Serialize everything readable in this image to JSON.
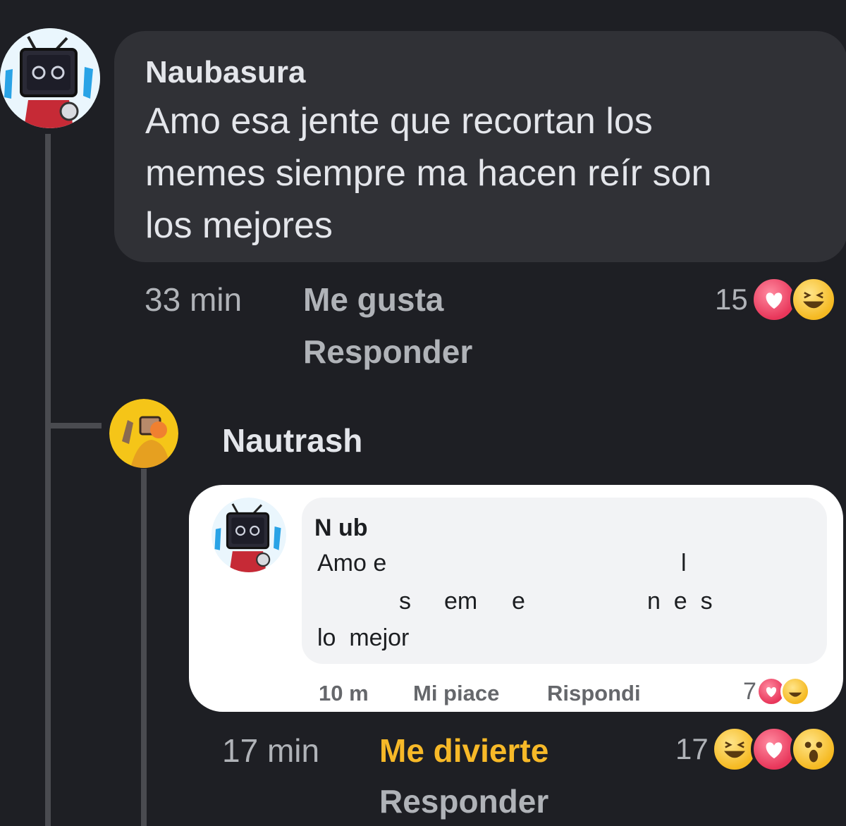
{
  "comment": {
    "author": "Naubasura",
    "text_lines": [
      "Amo esa jente que recortan los",
      "memes siempre ma hacen reír son",
      "los mejores"
    ],
    "time": "33 min",
    "like_label": "Me gusta",
    "reply_label": "Responder",
    "reaction_count": "15",
    "reactions": [
      "love-icon",
      "haha-icon"
    ]
  },
  "reply": {
    "author": "Nautrash",
    "time": "17 min",
    "reaction_label": "Me divierte",
    "reply_label": "Responder",
    "reaction_count": "17",
    "reactions": [
      "haha-icon",
      "love-icon",
      "wow-icon"
    ],
    "reaction_color": "#f7b928"
  },
  "screenshot": {
    "author": "N  ub",
    "line1_a": "Amo e",
    "line1_b": "l",
    "line2_a": "s",
    "line2_b": "em",
    "line2_c": "e",
    "line2_d": "n  e  s",
    "line3": "lo  mejor",
    "time": "10 m",
    "like_label": "Mi piace",
    "reply_label": "Rispondi",
    "reaction_count": "7"
  }
}
